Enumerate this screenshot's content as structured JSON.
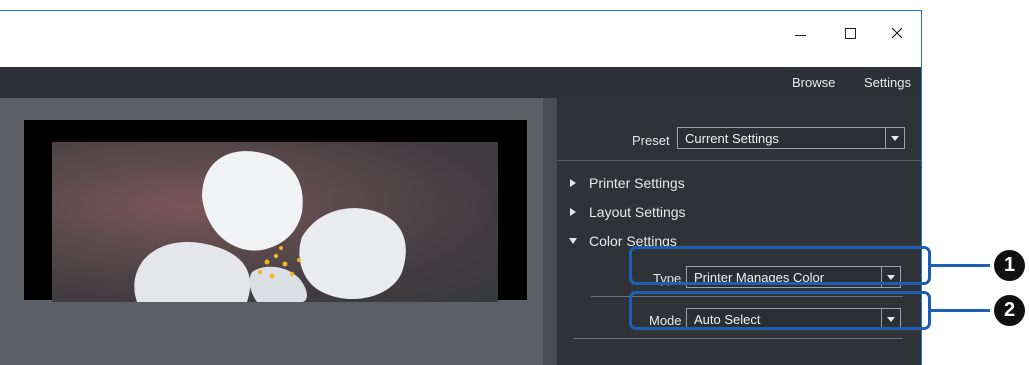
{
  "window_controls": {
    "minimize_icon": "minimize-icon",
    "maximize_icon": "maximize-icon",
    "close_icon": "close-icon"
  },
  "menubar": {
    "browse_label": "Browse",
    "settings_label": "Settings"
  },
  "panel": {
    "preset": {
      "label": "Preset",
      "value": "Current Settings"
    },
    "sections": [
      {
        "label": "Printer Settings",
        "expanded": false
      },
      {
        "label": "Layout Settings",
        "expanded": false
      },
      {
        "label": "Color Settings",
        "expanded": true
      }
    ],
    "color_settings": {
      "type": {
        "label": "Type",
        "value": "Printer Manages Color"
      },
      "mode": {
        "label": "Mode",
        "value": "Auto Select"
      }
    }
  },
  "callouts": [
    {
      "number": "1"
    },
    {
      "number": "2"
    }
  ],
  "colors": {
    "callout_accent": "#1e5fb4",
    "menubar_bg": "#2d3136",
    "panel_bg": "#2f3338"
  }
}
